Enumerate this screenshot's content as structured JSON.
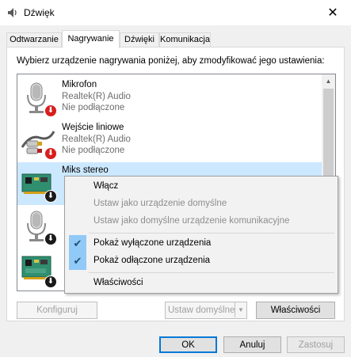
{
  "window": {
    "title": "Dźwięk",
    "close_glyph": "✕"
  },
  "tabs": [
    {
      "label": "Odtwarzanie",
      "active": false
    },
    {
      "label": "Nagrywanie",
      "active": true
    },
    {
      "label": "Dźwięki",
      "active": false
    },
    {
      "label": "Komunikacja",
      "active": false
    }
  ],
  "panel": {
    "instruction": "Wybierz urządzenie nagrywania poniżej, aby zmodyfikować jego ustawienia:"
  },
  "devices": [
    {
      "name": "Mikrofon",
      "driver": "Realtek(R) Audio",
      "status": "Nie podłączone",
      "icon": "microphone-icon",
      "badge": "red-down-arrow"
    },
    {
      "name": "Wejście liniowe",
      "driver": "Realtek(R) Audio",
      "status": "Nie podłączone",
      "icon": "line-in-cable-icon",
      "badge": "red-down-arrow"
    },
    {
      "name": "Miks stereo",
      "driver": "",
      "status": "",
      "icon": "sound-card-icon",
      "badge": "black-down-arrow",
      "selected": true
    },
    {
      "name": "",
      "driver": "",
      "status": "",
      "icon": "microphone-icon",
      "badge": "black-down-arrow"
    },
    {
      "name": "",
      "driver": "",
      "status": "",
      "icon": "sound-card-icon",
      "badge": "black-down-arrow"
    }
  ],
  "context_menu": {
    "items": [
      {
        "label": "Włącz",
        "enabled": true,
        "checked": false
      },
      {
        "label": "Ustaw jako urządzenie domyślne",
        "enabled": false,
        "checked": false
      },
      {
        "label": "Ustaw jako domyślne urządzenie komunikacyjne",
        "enabled": false,
        "checked": false
      },
      {
        "label": "Pokaż wyłączone urządzenia",
        "enabled": true,
        "checked": true
      },
      {
        "label": "Pokaż odłączone urządzenia",
        "enabled": true,
        "checked": true
      },
      {
        "label": "Właściwości",
        "enabled": true,
        "checked": false
      }
    ],
    "check_glyph": "✔"
  },
  "panel_buttons": {
    "configure": "Konfiguruj",
    "set_default": "Ustaw domyślne",
    "properties": "Właściwości"
  },
  "dialog_buttons": {
    "ok": "OK",
    "cancel": "Anuluj",
    "apply": "Zastosuj"
  },
  "colors": {
    "selection": "#cce8ff",
    "menu_check_bg": "#91c9f7",
    "default_button_border": "#0078d7",
    "disconnected_badge": "#d81e1e"
  }
}
